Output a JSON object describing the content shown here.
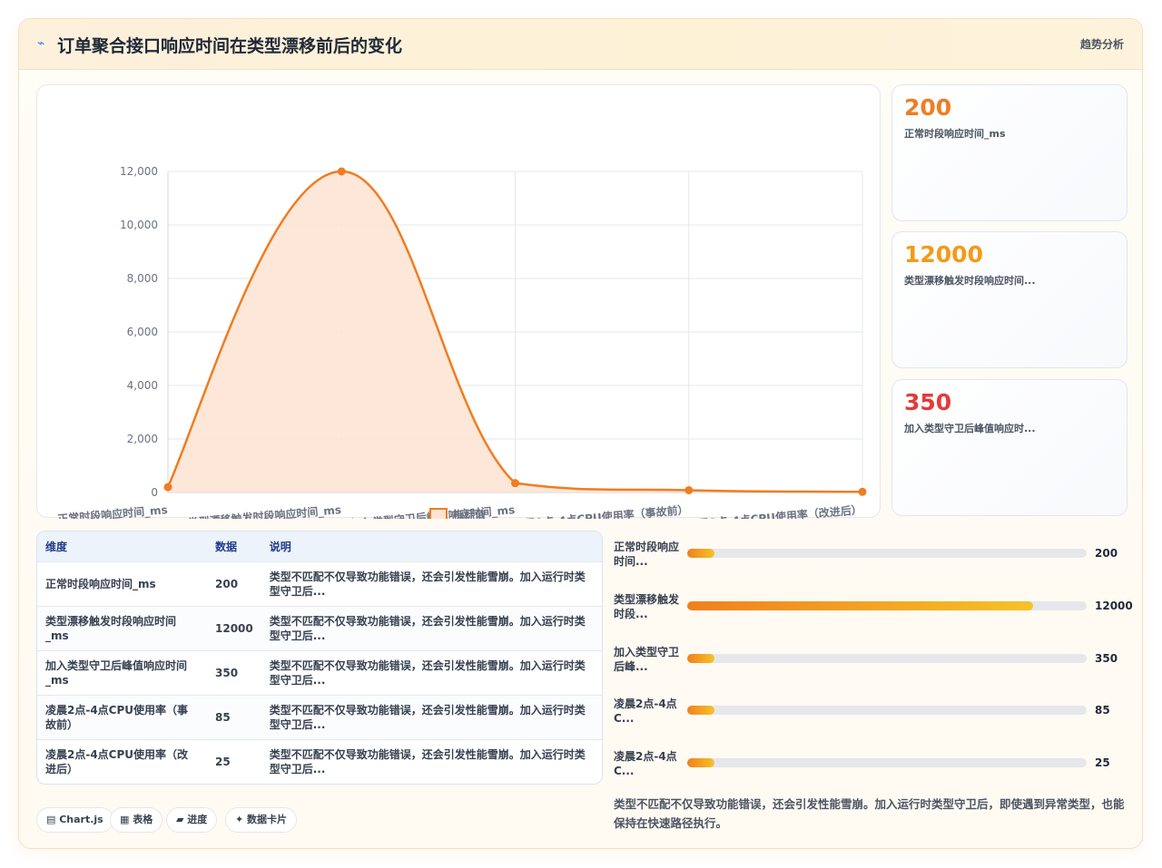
{
  "header": {
    "icon": "chart-line-icon",
    "icon_glyph": "⌁",
    "title": "订单聚合接口响应时间在类型漂移前后的变化",
    "tag": "趋势分析"
  },
  "chart_data": {
    "type": "area",
    "categories": [
      "正常时段响应时间_ms",
      "类型漂移触发时段响应时间_ms",
      "加入类型守卫后峰值响应时间_ms",
      "凌晨2点-4点CPU使用率（事故前）",
      "凌晨2点-4点CPU使用率（改进后）"
    ],
    "series": [
      {
        "name": "指标值",
        "values": [
          200,
          12000,
          350,
          85,
          25
        ]
      }
    ],
    "ylim": [
      0,
      12000
    ],
    "yticks": [
      "0",
      "2,000",
      "4,000",
      "6,000",
      "8,000",
      "10,000",
      "12,000"
    ],
    "ytick_values": [
      0,
      2000,
      4000,
      6000,
      8000,
      10000,
      12000
    ],
    "grid": true,
    "legend_position": "bottom",
    "line_color": "#ef7d22",
    "fill_color": "#fde3d2"
  },
  "kpis": [
    {
      "value": "200",
      "label": "正常时段响应时间_ms",
      "color": "#ef7d22"
    },
    {
      "value": "12000",
      "label": "类型漂移触发时段响应时间...",
      "color": "#f29a18"
    },
    {
      "value": "350",
      "label": "加入类型守卫后峰值响应时...",
      "color": "#e23b3b"
    }
  ],
  "table": {
    "headers": [
      "维度",
      "数据",
      "说明"
    ],
    "rows": [
      {
        "dim": "正常时段响应时间_ms",
        "value": "200",
        "desc": "类型不匹配不仅导致功能错误，还会引发性能雪崩。加入运行时类型守卫后..."
      },
      {
        "dim": "类型漂移触发时段响应时间_ms",
        "value": "12000",
        "desc": "类型不匹配不仅导致功能错误，还会引发性能雪崩。加入运行时类型守卫后..."
      },
      {
        "dim": "加入类型守卫后峰值响应时间_ms",
        "value": "350",
        "desc": "类型不匹配不仅导致功能错误，还会引发性能雪崩。加入运行时类型守卫后..."
      },
      {
        "dim": "凌晨2点-4点CPU使用率（事故前）",
        "value": "85",
        "desc": "类型不匹配不仅导致功能错误，还会引发性能雪崩。加入运行时类型守卫后..."
      },
      {
        "dim": "凌晨2点-4点CPU使用率（改进后）",
        "value": "25",
        "desc": "类型不匹配不仅导致功能错误，还会引发性能雪崩。加入运行时类型守卫后..."
      }
    ]
  },
  "progress": {
    "max": 12000,
    "items": [
      {
        "label": "正常时段响应时间...",
        "value": "200",
        "fraction": 0.0167
      },
      {
        "label": "类型漂移触发时段...",
        "value": "12000",
        "fraction": 1.0
      },
      {
        "label": "加入类型守卫后峰...",
        "value": "350",
        "fraction": 0.0292
      },
      {
        "label": "凌晨2点-4点C...",
        "value": "85",
        "fraction": 0.0071
      },
      {
        "label": "凌晨2点-4点C...",
        "value": "25",
        "fraction": 0.0021
      }
    ]
  },
  "note": "类型不匹配不仅导致功能错误，还会引发性能雪崩。加入运行时类型守卫后，即使遇到异常类型，也能保持在快速路径执行。",
  "chips": [
    {
      "label": "▤ Chart.js"
    },
    {
      "label": "▦ 表格"
    },
    {
      "label": "▰ 进度"
    },
    {
      "label": "✦ 数据卡片"
    }
  ]
}
